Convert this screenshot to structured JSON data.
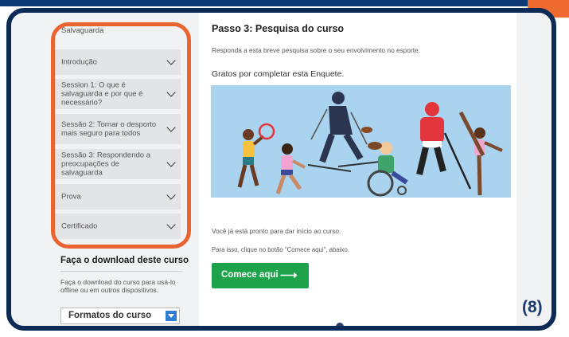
{
  "sidebar": {
    "items": [
      {
        "label": "Salvaguarda"
      },
      {
        "label": "Introdução"
      },
      {
        "label": "Session 1: O que é salvaguarda e por que é necessário?"
      },
      {
        "label": "Sessão 2: Tornar o desporto mais seguro para todos"
      },
      {
        "label": "Sessão 3: Respondendo a preocupações de salvaguarda"
      },
      {
        "label": "Prova"
      },
      {
        "label": "Certificado"
      }
    ]
  },
  "download": {
    "title": "Faça o download deste curso",
    "description": "Faça o download do curso para usá-lo offline ou em outros dispositivos.",
    "select_value": "Formatos do curso"
  },
  "main": {
    "step_title": "Passo 3: Pesquisa do curso",
    "step_subtitle": "Responda a esta breve pesquisa sobre o seu envolvimento no esporte.",
    "thanks": "Gratos por completar esta Enquete.",
    "ready_text": "Você já está pronto para dar início ao curso.",
    "instruction": "Para isso, clique no botão \"Comece aqui\", abaixo.",
    "start_button": "Comece aqui",
    "start_arrow": "⟶"
  },
  "page_marker": "(8)",
  "colors": {
    "accent_orange": "#ea6432",
    "navy": "#0b2a55",
    "green": "#1fa34a",
    "illustration_bg": "#a9d3ee"
  }
}
